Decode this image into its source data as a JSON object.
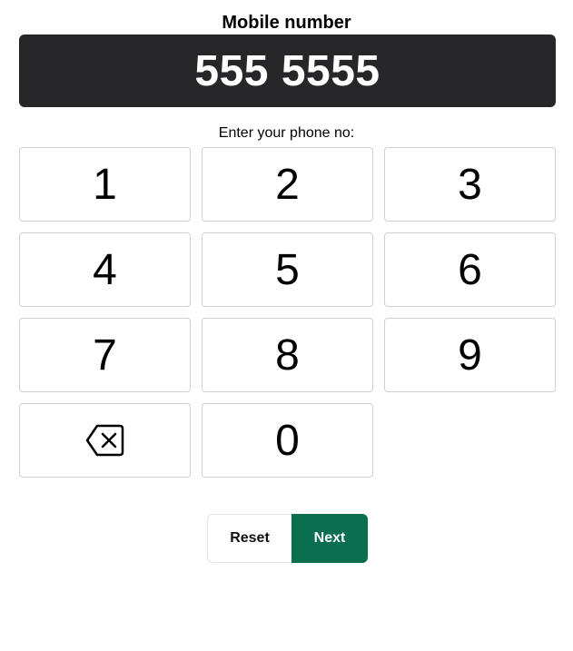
{
  "header": {
    "title": "Mobile number"
  },
  "display": {
    "value": "555 5555"
  },
  "prompt": "Enter your phone no:",
  "keypad": {
    "keys": [
      "1",
      "2",
      "3",
      "4",
      "5",
      "6",
      "7",
      "8",
      "9"
    ],
    "zero": "0",
    "backspace_icon": "backspace-icon"
  },
  "actions": {
    "reset_label": "Reset",
    "next_label": "Next"
  },
  "colors": {
    "display_bg": "#27272a",
    "accent": "#0b6e4f"
  }
}
